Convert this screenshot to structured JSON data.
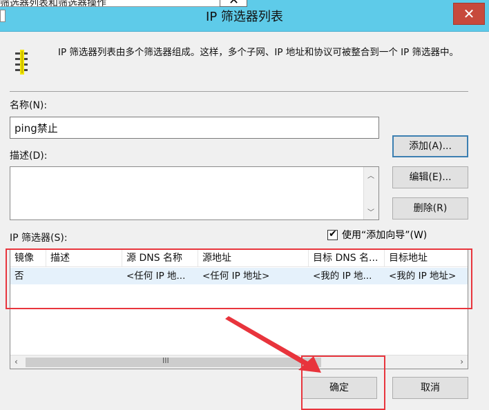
{
  "dialog": {
    "title": "IP 筛选器列表",
    "close_glyph": "✕"
  },
  "background_window": {
    "title_fragment": "筛选器列表和筛选器操作"
  },
  "header": {
    "icon": "filter-list-icon",
    "info": "IP 筛选器列表由多个筛选器组成。这样，多个子网、IP 地址和协议可被整合到一个 IP 筛选器中。"
  },
  "form": {
    "name_label": "名称(N):",
    "name_value": "ping禁止",
    "description_label": "描述(D):",
    "description_value": "",
    "filters_label": "IP 筛选器(S):",
    "use_wizard_label": "使用“添加向导”(W)",
    "use_wizard_checked": true
  },
  "buttons": {
    "add": "添加(A)...",
    "edit": "编辑(E)...",
    "remove": "删除(R)",
    "ok": "确定",
    "cancel": "取消"
  },
  "filter_table": {
    "columns": [
      "镜像",
      "描述",
      "源 DNS 名称",
      "源地址",
      "目标 DNS 名...",
      "目标地址"
    ],
    "rows": [
      [
        "否",
        "",
        "<任何 IP 地...",
        "<任何 IP 地址>",
        "<我的 IP 地...",
        "<我的 IP 地址>"
      ]
    ]
  },
  "scrollbar": {
    "grip": "III",
    "left_arrow": "‹",
    "right_arrow": "›",
    "up_arrow": "︿",
    "down_arrow": "﹀"
  },
  "colors": {
    "titlebar": "#5ecbe9",
    "close_button": "#c74a3c",
    "annotation": "#e8343c",
    "selected_row": "#e5f1fb"
  }
}
